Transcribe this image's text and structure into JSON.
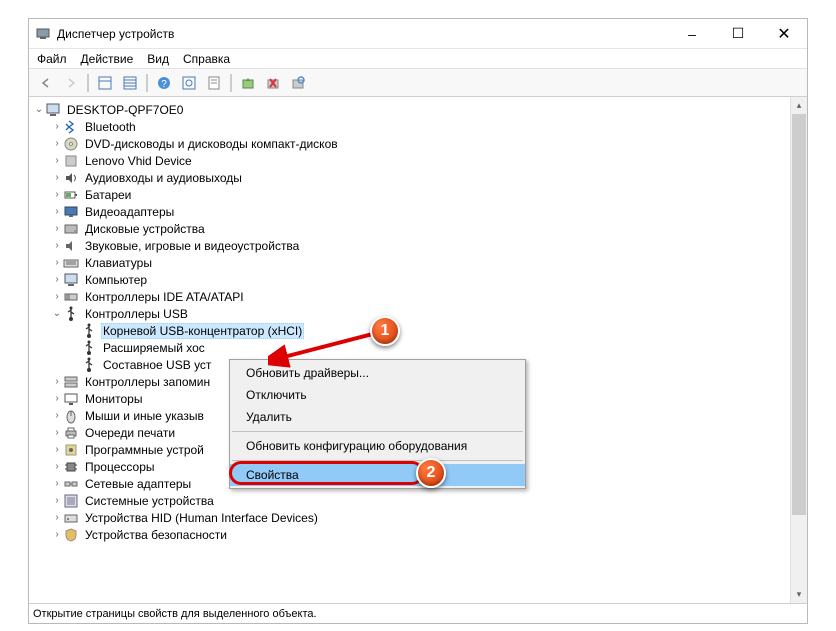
{
  "window": {
    "title": "Диспетчер устройств"
  },
  "menubar": {
    "file": "Файл",
    "action": "Действие",
    "view": "Вид",
    "help": "Справка"
  },
  "wincontrols": {
    "min": "–",
    "max": "☐",
    "close": "✕"
  },
  "statusbar": {
    "text": "Открытие страницы свойств для выделенного объекта."
  },
  "tree": {
    "root": "DESKTOP-QPF7OE0",
    "nodes": [
      {
        "label": "Bluetooth",
        "icon": "bluetooth-icon"
      },
      {
        "label": "DVD-дисководы и дисководы компакт-дисков",
        "icon": "dvd-icon"
      },
      {
        "label": "Lenovo Vhid Device",
        "icon": "device-icon"
      },
      {
        "label": "Аудиовходы и аудиовыходы",
        "icon": "audio-icon"
      },
      {
        "label": "Батареи",
        "icon": "battery-icon"
      },
      {
        "label": "Видеоадаптеры",
        "icon": "display-icon"
      },
      {
        "label": "Дисковые устройства",
        "icon": "disk-icon"
      },
      {
        "label": "Звуковые, игровые и видеоустройства",
        "icon": "sound-icon"
      },
      {
        "label": "Клавиатуры",
        "icon": "keyboard-icon"
      },
      {
        "label": "Компьютер",
        "icon": "computer-icon"
      },
      {
        "label": "Контроллеры IDE ATA/ATAPI",
        "icon": "ide-icon"
      },
      {
        "label": "Контроллеры USB",
        "icon": "usb-icon",
        "expanded": true,
        "children": [
          {
            "label": "Корневой USB-концентратор (xHCI)",
            "icon": "usb-icon",
            "selected": true
          },
          {
            "label": "Расширяемый хос",
            "icon": "usb-icon"
          },
          {
            "label": "Составное USB уст",
            "icon": "usb-icon"
          }
        ]
      },
      {
        "label": "Контроллеры запомин",
        "icon": "storage-icon"
      },
      {
        "label": "Мониторы",
        "icon": "monitor-icon"
      },
      {
        "label": "Мыши и иные указыв",
        "icon": "mouse-icon"
      },
      {
        "label": "Очереди печати",
        "icon": "printer-icon"
      },
      {
        "label": "Программные устрой",
        "icon": "software-icon"
      },
      {
        "label": "Процессоры",
        "icon": "cpu-icon"
      },
      {
        "label": "Сетевые адаптеры",
        "icon": "network-icon"
      },
      {
        "label": "Системные устройства",
        "icon": "system-icon"
      },
      {
        "label": "Устройства HID (Human Interface Devices)",
        "icon": "hid-icon"
      },
      {
        "label": "Устройства безопасности",
        "icon": "security-icon"
      }
    ]
  },
  "context_menu": {
    "items": [
      {
        "label": "Обновить драйверы..."
      },
      {
        "label": "Отключить"
      },
      {
        "label": "Удалить"
      },
      {
        "sep": true
      },
      {
        "label": "Обновить конфигурацию оборудования"
      },
      {
        "sep": true
      },
      {
        "label": "Свойства",
        "highlighted": true
      }
    ]
  },
  "markers": {
    "one": "1",
    "two": "2"
  }
}
